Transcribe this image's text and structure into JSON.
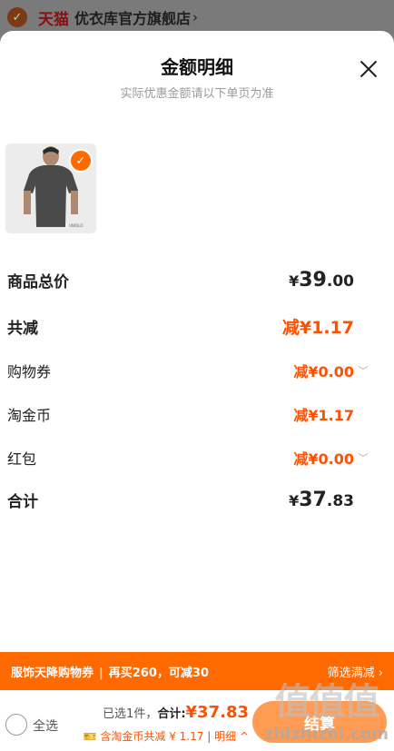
{
  "store_bar": {
    "brand": "天猫",
    "shop_name": "优衣库官方旗舰店"
  },
  "sheet": {
    "title": "金额明细",
    "subtitle": "实际优惠金额请以下单页为准"
  },
  "rows": [
    {
      "label": "商品总价",
      "currency": "¥",
      "integer": "39",
      "decimal": ".00"
    },
    {
      "label": "共减",
      "value": "减¥1.17"
    },
    {
      "label": "购物券",
      "value": "减¥0.00"
    },
    {
      "label": "淘金币",
      "value": "减¥1.17"
    },
    {
      "label": "红包",
      "value": "减¥0.00"
    },
    {
      "label": "合计",
      "currency": "¥",
      "integer": "37",
      "decimal": ".83"
    }
  ],
  "promo": {
    "title": "服饰天降购物券",
    "detail": "再买260，可减30",
    "action": "筛选满减"
  },
  "footer": {
    "select_all": "全选",
    "selected_count": "已选1件，",
    "total_label": "合计:",
    "total_value": "¥37.83",
    "coin_note": "含淘金币共减 ¥ 1.17",
    "detail_link": "明细",
    "checkout_label": "结算"
  },
  "watermark": {
    "cn": "值值值",
    "en": "zhizhizhi.com"
  },
  "colors": {
    "accent": "#ff5000",
    "promo": "#ff6a00"
  }
}
